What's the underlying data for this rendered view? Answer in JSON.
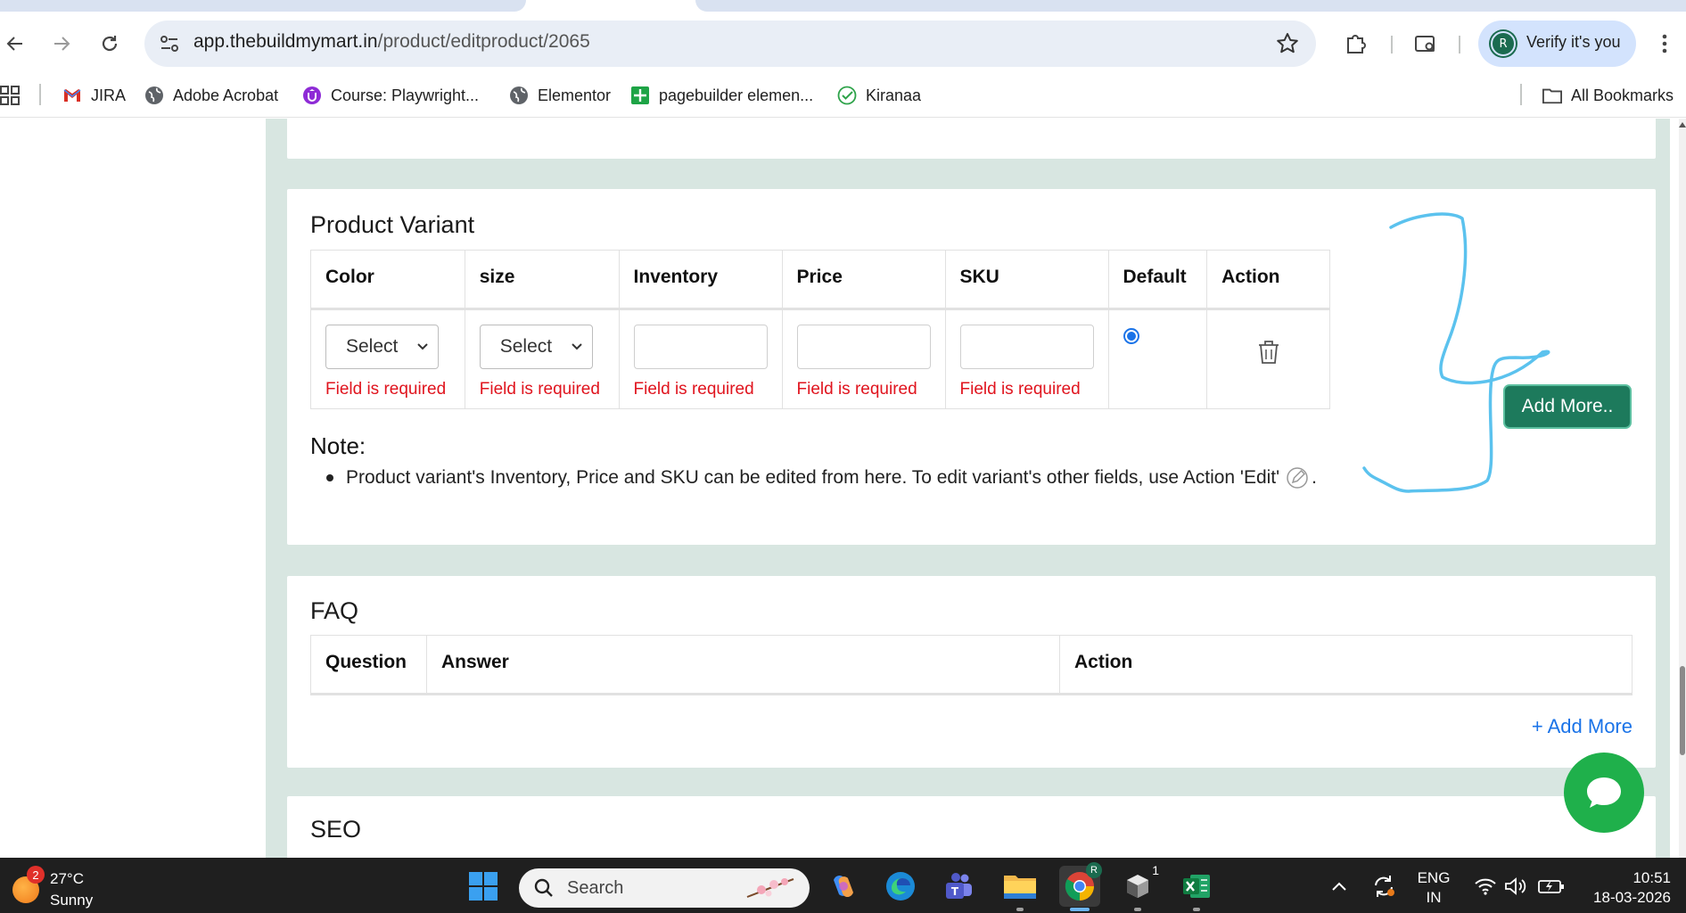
{
  "browser": {
    "url_host": "app.thebuildmymart.in",
    "url_path": "/product/editproduct/2065",
    "profile_initial": "R",
    "verify_label": "Verify it's you",
    "bookmarks": [
      {
        "label": "JIRA",
        "icon": "gmail-icon"
      },
      {
        "label": "Adobe Acrobat",
        "icon": "globe-icon"
      },
      {
        "label": "Course: Playwright...",
        "icon": "udemy-icon"
      },
      {
        "label": "Elementor",
        "icon": "globe-icon"
      },
      {
        "label": "pagebuilder elemen...",
        "icon": "sheets-icon"
      },
      {
        "label": "Kiranaa",
        "icon": "check-circle-icon"
      }
    ],
    "all_bookmarks_label": "All Bookmarks"
  },
  "variant": {
    "title": "Product Variant",
    "headers": [
      "Color",
      "size",
      "Inventory",
      "Price",
      "SKU",
      "Default",
      "Action"
    ],
    "select_placeholder": "Select",
    "error_text": "Field is required",
    "note_title": "Note:",
    "note_text": "Product variant's Inventory, Price and SKU can be edited from here. To edit variant's other fields, use Action 'Edit'",
    "note_suffix": ".",
    "add_more_label": "Add More.."
  },
  "faq": {
    "title": "FAQ",
    "headers": [
      "Question",
      "Answer",
      "Action"
    ],
    "add_more_label": "+ Add More"
  },
  "seo": {
    "title": "SEO"
  },
  "taskbar": {
    "weather_badge": "2",
    "temperature": "27°C",
    "condition": "Sunny",
    "search_label": "Search",
    "edge_badge_hidden": "",
    "chrome_badge": "R",
    "cube_badge": "1",
    "language_top": "ENG",
    "language_bottom": "IN",
    "time": "10:51",
    "date": "18-03-2026"
  },
  "colors": {
    "accent_green": "#1d7a5c",
    "error_red": "#e0141e",
    "link_blue": "#1a73e8",
    "page_bg": "#d8e6e1",
    "chat_green": "#1fb04b",
    "scribble_blue": "#5bc2ee"
  }
}
